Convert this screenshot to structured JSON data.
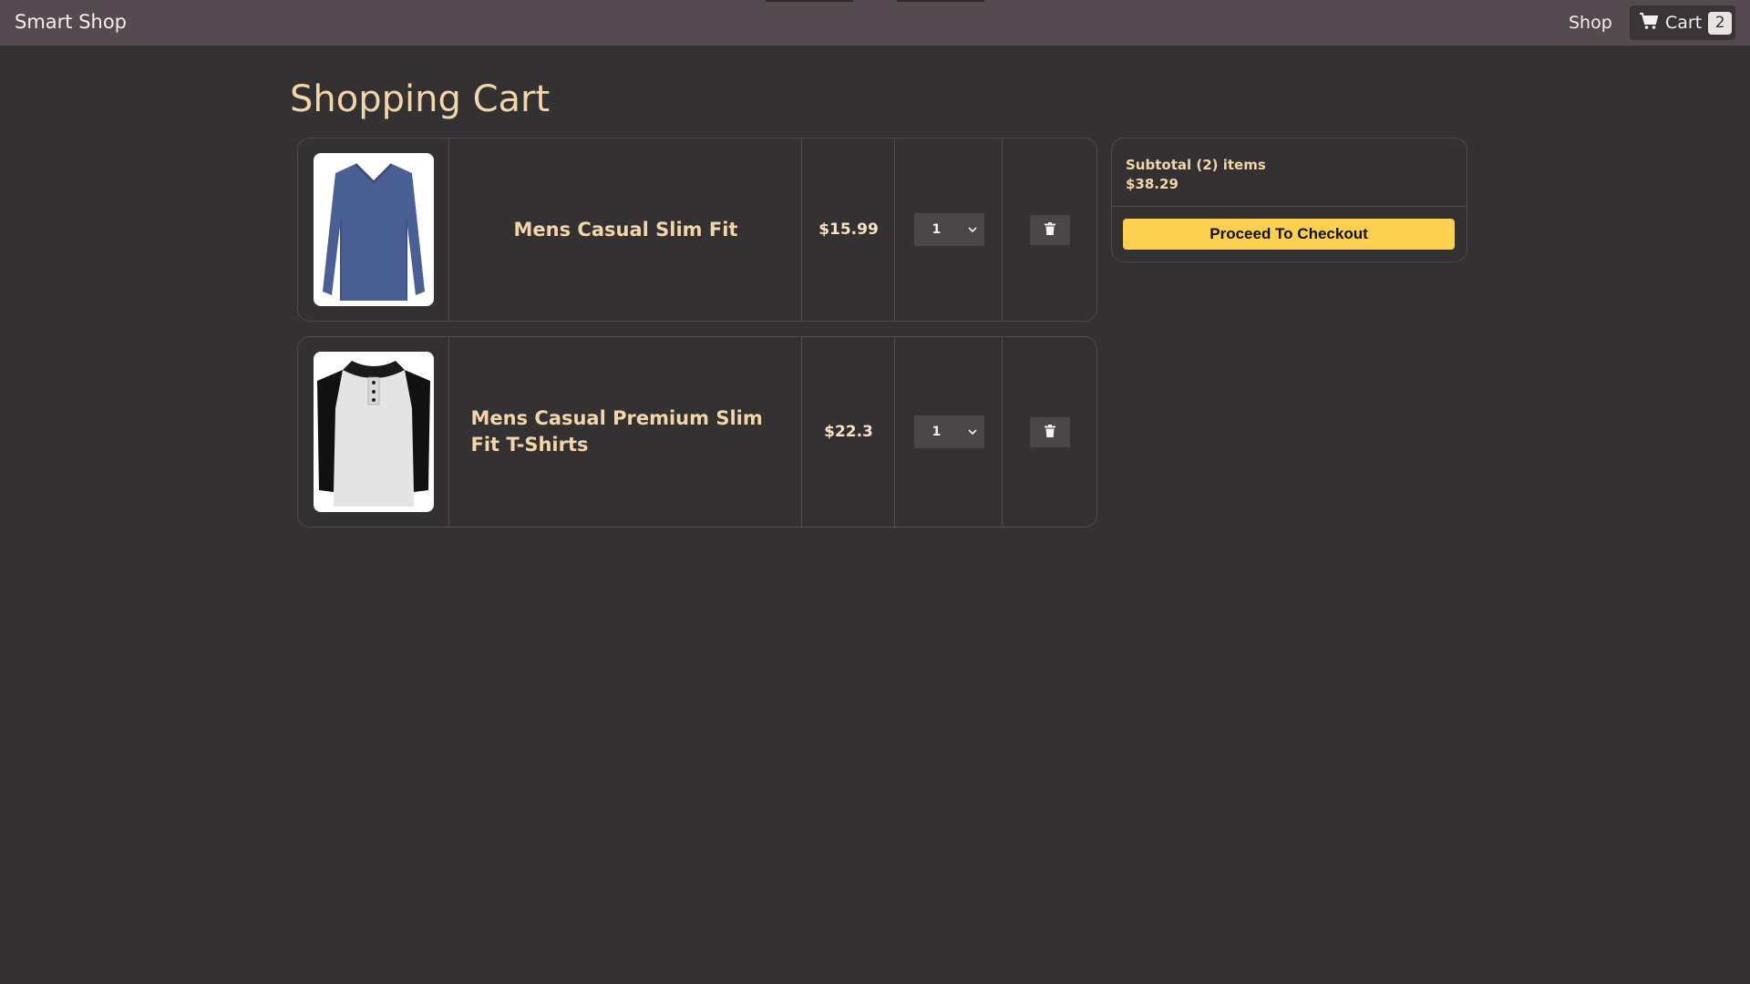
{
  "navbar": {
    "brand": "Smart Shop",
    "shop_link": "Shop",
    "cart_link": "Cart",
    "cart_count": "2",
    "cart_icon": "shopping-cart-icon"
  },
  "page_title": "Shopping Cart",
  "cart_items": [
    {
      "name": "Mens Casual Slim Fit",
      "price": "$15.99",
      "quantity": "1",
      "image": "blue-long-sleeve-shirt",
      "delete_icon": "trash-icon"
    },
    {
      "name": "Mens Casual Premium Slim Fit T-Shirts",
      "price": "$22.3",
      "quantity": "1",
      "image": "raglan-henley-shirt",
      "delete_icon": "trash-icon"
    }
  ],
  "summary": {
    "subtotal_label": "Subtotal (2) items",
    "subtotal_value": "$38.29",
    "checkout_label": "Proceed To Checkout"
  },
  "colors": {
    "background": "#333132",
    "navbar": "#544a4f",
    "accent_text": "#f2d5a8",
    "checkout_button": "#fbcf4f"
  }
}
